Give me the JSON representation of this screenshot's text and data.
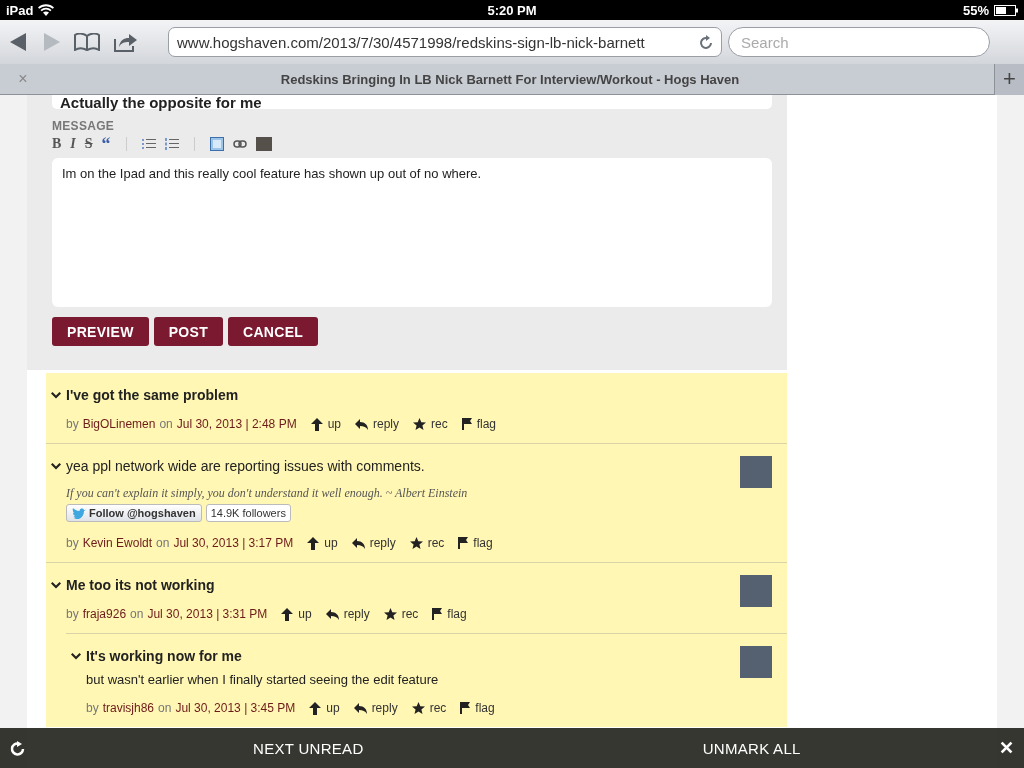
{
  "status_bar": {
    "device": "iPad",
    "time": "5:20 PM",
    "battery": "55%"
  },
  "browser": {
    "url": "www.hogshaven.com/2013/7/30/4571998/redskins-sign-lb-nick-barnett",
    "search_placeholder": "Search",
    "forward_disabled": true,
    "tab_close": "×",
    "tab_title": "Redskins Bringing In LB Nick Barnett For Interview/Workout - Hogs Haven",
    "new_tab": "+"
  },
  "reply_form": {
    "subject": "Actually the opposite for me",
    "message_label": "MESSAGE",
    "editor_tools": [
      {
        "kind": "bold",
        "label": "B"
      },
      {
        "kind": "italic",
        "label": "I"
      },
      {
        "kind": "strike",
        "label": "S"
      },
      {
        "kind": "quote",
        "label": "“"
      },
      {
        "kind": "sep"
      },
      {
        "kind": "bullets"
      },
      {
        "kind": "numbers"
      },
      {
        "kind": "sep"
      },
      {
        "kind": "image"
      },
      {
        "kind": "link"
      },
      {
        "kind": "video"
      }
    ],
    "message": "Im on the Ipad and this really cool feature has shown up out of no where.",
    "buttons": [
      "PREVIEW",
      "POST",
      "CANCEL"
    ]
  },
  "comments": [
    {
      "title": "I've got the same problem",
      "title_bold": true,
      "avatar": false,
      "by": "by",
      "author": "BigOLinemen",
      "on": "on",
      "date": "Jul 30, 2013 | 2:48 PM",
      "actions": [
        {
          "kind": "up",
          "label": "up"
        },
        {
          "kind": "reply",
          "label": "reply"
        },
        {
          "kind": "rec",
          "label": "rec"
        },
        {
          "kind": "flag",
          "label": "flag"
        }
      ]
    },
    {
      "title": "yea ppl network wide are reporting issues with comments.",
      "title_bold": false,
      "avatar": true,
      "signature": "If you can't explain it simply, you don't understand it well enough. ~ Albert Einstein",
      "follow": {
        "button": "Follow @hogshaven",
        "count": "14.9K followers"
      },
      "by": "by",
      "author": "Kevin Ewoldt",
      "on": "on",
      "date": "Jul 30, 2013 | 3:17 PM",
      "actions": [
        {
          "kind": "up",
          "label": "up"
        },
        {
          "kind": "reply",
          "label": "reply"
        },
        {
          "kind": "rec",
          "label": "rec"
        },
        {
          "kind": "flag",
          "label": "flag"
        }
      ]
    },
    {
      "title": "Me too its not working",
      "title_bold": true,
      "avatar": true,
      "by": "by",
      "author": "fraja926",
      "on": "on",
      "date": "Jul 30, 2013 | 3:31 PM",
      "actions": [
        {
          "kind": "up",
          "label": "up"
        },
        {
          "kind": "reply",
          "label": "reply"
        },
        {
          "kind": "rec",
          "label": "rec"
        },
        {
          "kind": "flag",
          "label": "flag"
        }
      ],
      "children": [
        {
          "title": "It's working now for me",
          "title_bold": true,
          "avatar": true,
          "body": "but wasn't earlier when I finally started seeing the edit feature",
          "by": "by",
          "author": "travisjh86",
          "on": "on",
          "date": "Jul 30, 2013 | 3:45 PM",
          "actions": [
            {
              "kind": "up",
              "label": "up"
            },
            {
              "kind": "reply",
              "label": "reply"
            },
            {
              "kind": "rec",
              "label": "rec"
            },
            {
              "kind": "flag",
              "label": "flag"
            }
          ]
        }
      ]
    }
  ],
  "bottom_bar": {
    "next": "NEXT UNREAD",
    "unmark": "UNMARK ALL",
    "close": "✕"
  }
}
